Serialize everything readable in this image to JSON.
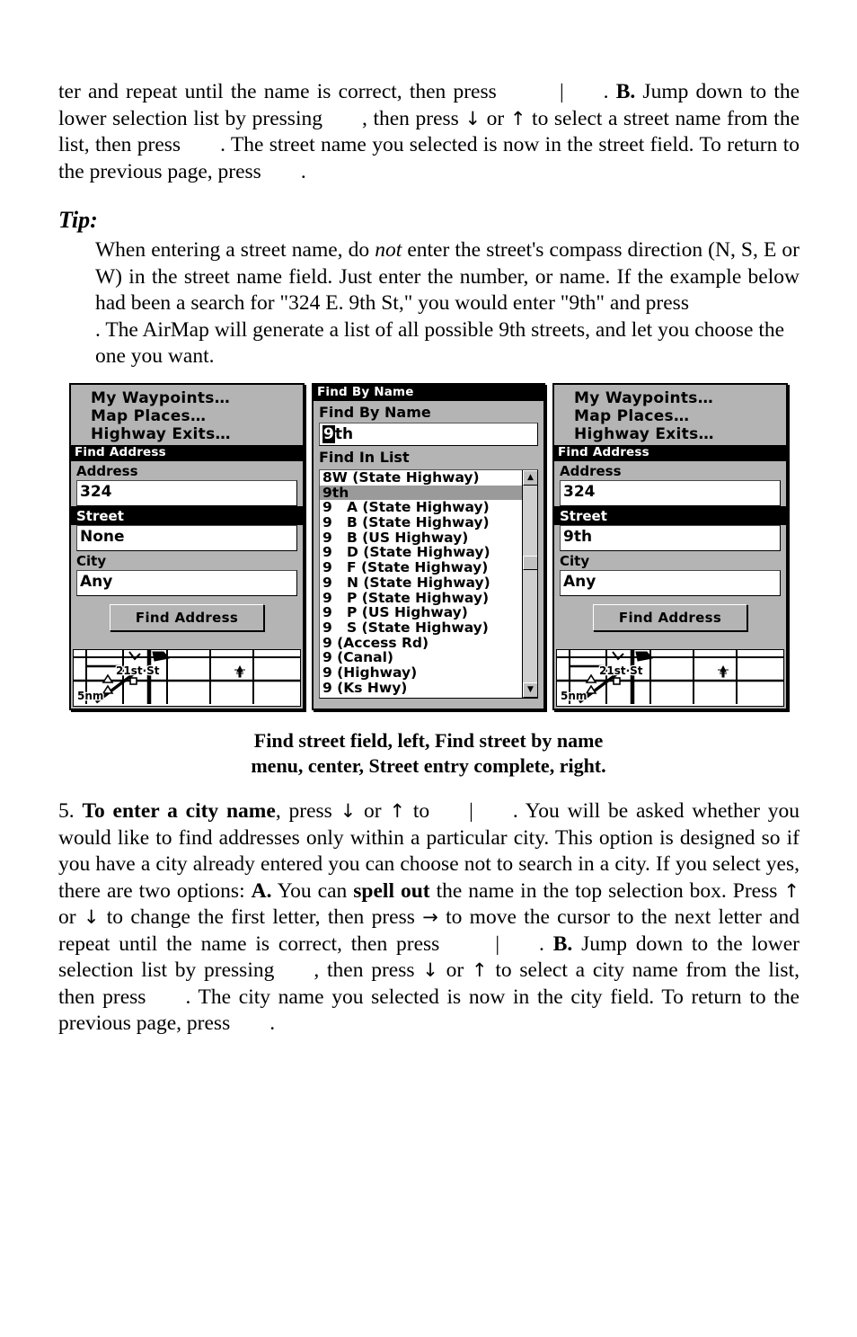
{
  "paragraph_top": {
    "lines": [
      "ter and repeat until the name is correct, then press",
      "| . B. Jump down to the lower selection list by pressing , then press ↓ or ↑ to select a street name from the list, then press . The street name you selected is now in the street field. To return to the previous page, press ."
    ],
    "seg_a": "ter and repeat until the name is correct, then press",
    "seg_b": "|",
    "seg_c": ". ",
    "seg_d": "B.",
    "seg_e": " Jump down to the lower selection list by pressing",
    "seg_f": ", then press ",
    "seg_g": "↓",
    "seg_h": " or ",
    "seg_i": "↑",
    "seg_j": " to select a street name from the list, then press",
    "seg_k": ". The street name you selected is now in the street field. To return to the previous page, press",
    "seg_l": "."
  },
  "tip": {
    "heading": "Tip:",
    "seg_a": "When entering a street name, do ",
    "seg_not": "not",
    "seg_b": " enter the street's compass direction (N, S, E or W) in the street name field. Just enter the number, or name. If the example below had been a search for \"324 E. 9th St,\" you would enter \"9th\" and press",
    "seg_c": ". The AirMap will generate a list of all possible 9th streets, and let you choose the one you want."
  },
  "figure": {
    "caption_line1": "Find street field, left, Find street by name",
    "caption_line2": "menu, center, Street entry complete, right.",
    "left_panel": {
      "menu_items": [
        "My Waypoints…",
        "Map Places…",
        "Highway Exits…"
      ],
      "title": "Find Address",
      "fields": [
        {
          "label": "Address",
          "value": "324",
          "selected": false
        },
        {
          "label": "Street",
          "value": "None",
          "selected": true
        },
        {
          "label": "City",
          "value": "Any",
          "selected": false
        }
      ],
      "button": "Find Address",
      "map": {
        "scale": "5nm",
        "street_label": "21st·St"
      }
    },
    "center_panel": {
      "title": "Find By Name",
      "field_label": "Find By Name",
      "input_cursor_char": "9",
      "input_rest": "th",
      "list_label": "Find In List",
      "list_items": [
        {
          "text": "8W (State Highway)",
          "selected": false
        },
        {
          "text": "9th",
          "selected": true
        },
        {
          "text": "9   A (State Highway)",
          "selected": false
        },
        {
          "text": "9   B (State Highway)",
          "selected": false
        },
        {
          "text": "9   B (US Highway)",
          "selected": false
        },
        {
          "text": "9   D (State Highway)",
          "selected": false
        },
        {
          "text": "9   F (State Highway)",
          "selected": false
        },
        {
          "text": "9   N (State Highway)",
          "selected": false
        },
        {
          "text": "9   P (State Highway)",
          "selected": false
        },
        {
          "text": "9   P (US Highway)",
          "selected": false
        },
        {
          "text": "9   S (State Highway)",
          "selected": false
        },
        {
          "text": "9 (Access Rd)",
          "selected": false
        },
        {
          "text": "9 (Canal)",
          "selected": false
        },
        {
          "text": "9 (Highway)",
          "selected": false
        },
        {
          "text": "9 (Ks Hwy)",
          "selected": false
        }
      ],
      "scroll_up_glyph": "▲",
      "scroll_down_glyph": "▼"
    },
    "right_panel": {
      "menu_items": [
        "My Waypoints…",
        "Map Places…",
        "Highway Exits…"
      ],
      "title": "Find Address",
      "fields": [
        {
          "label": "Address",
          "value": "324",
          "selected": false
        },
        {
          "label": "Street",
          "value": "9th",
          "selected": true
        },
        {
          "label": "City",
          "value": "Any",
          "selected": false
        }
      ],
      "button": "Find Address",
      "map": {
        "scale": "5nm",
        "street_label": "21st·St"
      }
    }
  },
  "paragraph_step5": {
    "number": "5.",
    "bold_a": "To enter a city name",
    "seg_a": ", press ",
    "arrow_down": "↓",
    "seg_b": " or ",
    "arrow_up": "↑",
    "seg_c": " to",
    "seg_pipe": "|",
    "seg_d": ". You will be asked whether you would like to find addresses only within a particular city. This option is designed so if you have a city already entered you can choose not to search in a city. If you select yes, there are two options: ",
    "bold_A": "A.",
    "seg_e": " You can ",
    "bold_spell": "spell out",
    "seg_f": " the name in the top selection box. Press ",
    "seg_g": " or ",
    "seg_h": " to change the first letter, then press ",
    "arrow_right": "→",
    "seg_i": " to move the cursor to the next letter and repeat until the name is correct, then press",
    "seg_j": ". ",
    "bold_B": "B.",
    "seg_k": " Jump down to the lower selection list by pressing",
    "seg_l": ", then press ",
    "seg_m": " or ",
    "seg_n": " to select a city name from the list, then press",
    "seg_o": ". The city name you selected is now in the city field. To return to the previous page, press",
    "seg_p": "."
  },
  "colors": {
    "screen_bg": "#b4b4b4",
    "title_bar": "#000000",
    "field_bg": "#ffffff",
    "selected_row": "#9a9a9a",
    "page_bg": "#ffffff"
  }
}
